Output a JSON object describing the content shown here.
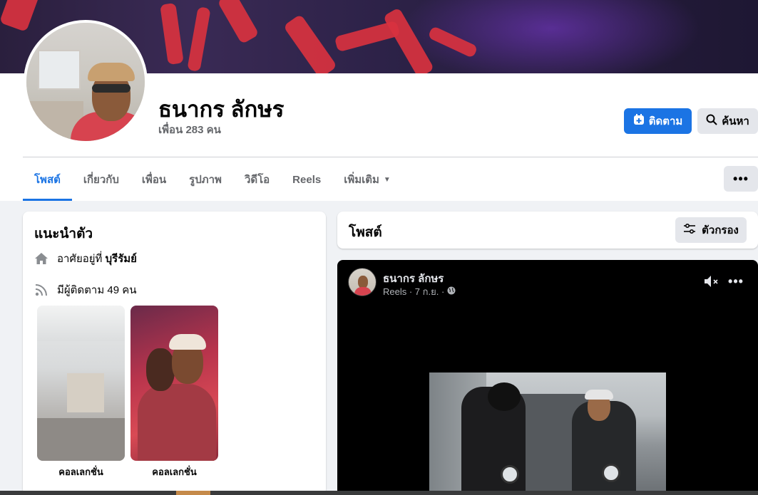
{
  "profile": {
    "name": "ธนากร ลักษร",
    "friends": "เพื่อน 283 คน"
  },
  "actions": {
    "follow_label": "ติดตาม",
    "search_label": "ค้นหา"
  },
  "tabs": [
    {
      "label": "โพสต์",
      "active": true
    },
    {
      "label": "เกี่ยวกับ"
    },
    {
      "label": "เพื่อน"
    },
    {
      "label": "รูปภาพ"
    },
    {
      "label": "วิดีโอ"
    },
    {
      "label": "Reels"
    },
    {
      "label": "เพิ่มเติม"
    }
  ],
  "more_label": "•••",
  "intro": {
    "title": "แนะนำตัว",
    "lives_prefix": "อาศัยอยู่ที่",
    "lives_place": "บุรีรัมย์",
    "followers": "มีผู้ติดตาม 49 คน",
    "collections": [
      {
        "label": "คอลเลกชั่น"
      },
      {
        "label": "คอลเลกชั่น"
      }
    ]
  },
  "posts": {
    "title": "โพสต์",
    "filter_label": "ตัวกรอง"
  },
  "reel_post": {
    "author": "ธนากร ลักษร",
    "meta": "Reels · 7 ก.ย. ·",
    "dots": "•••"
  },
  "colors": {
    "accent": "#1b74e4",
    "page_bg": "#f0f2f5",
    "card_bg": "#ffffff"
  },
  "icons": {
    "follow": "add-friend-icon",
    "search": "search-icon",
    "home": "home-icon",
    "rss": "rss-icon",
    "filter": "filter-icon",
    "globe": "globe-icon",
    "mute": "speaker-muted-icon"
  }
}
